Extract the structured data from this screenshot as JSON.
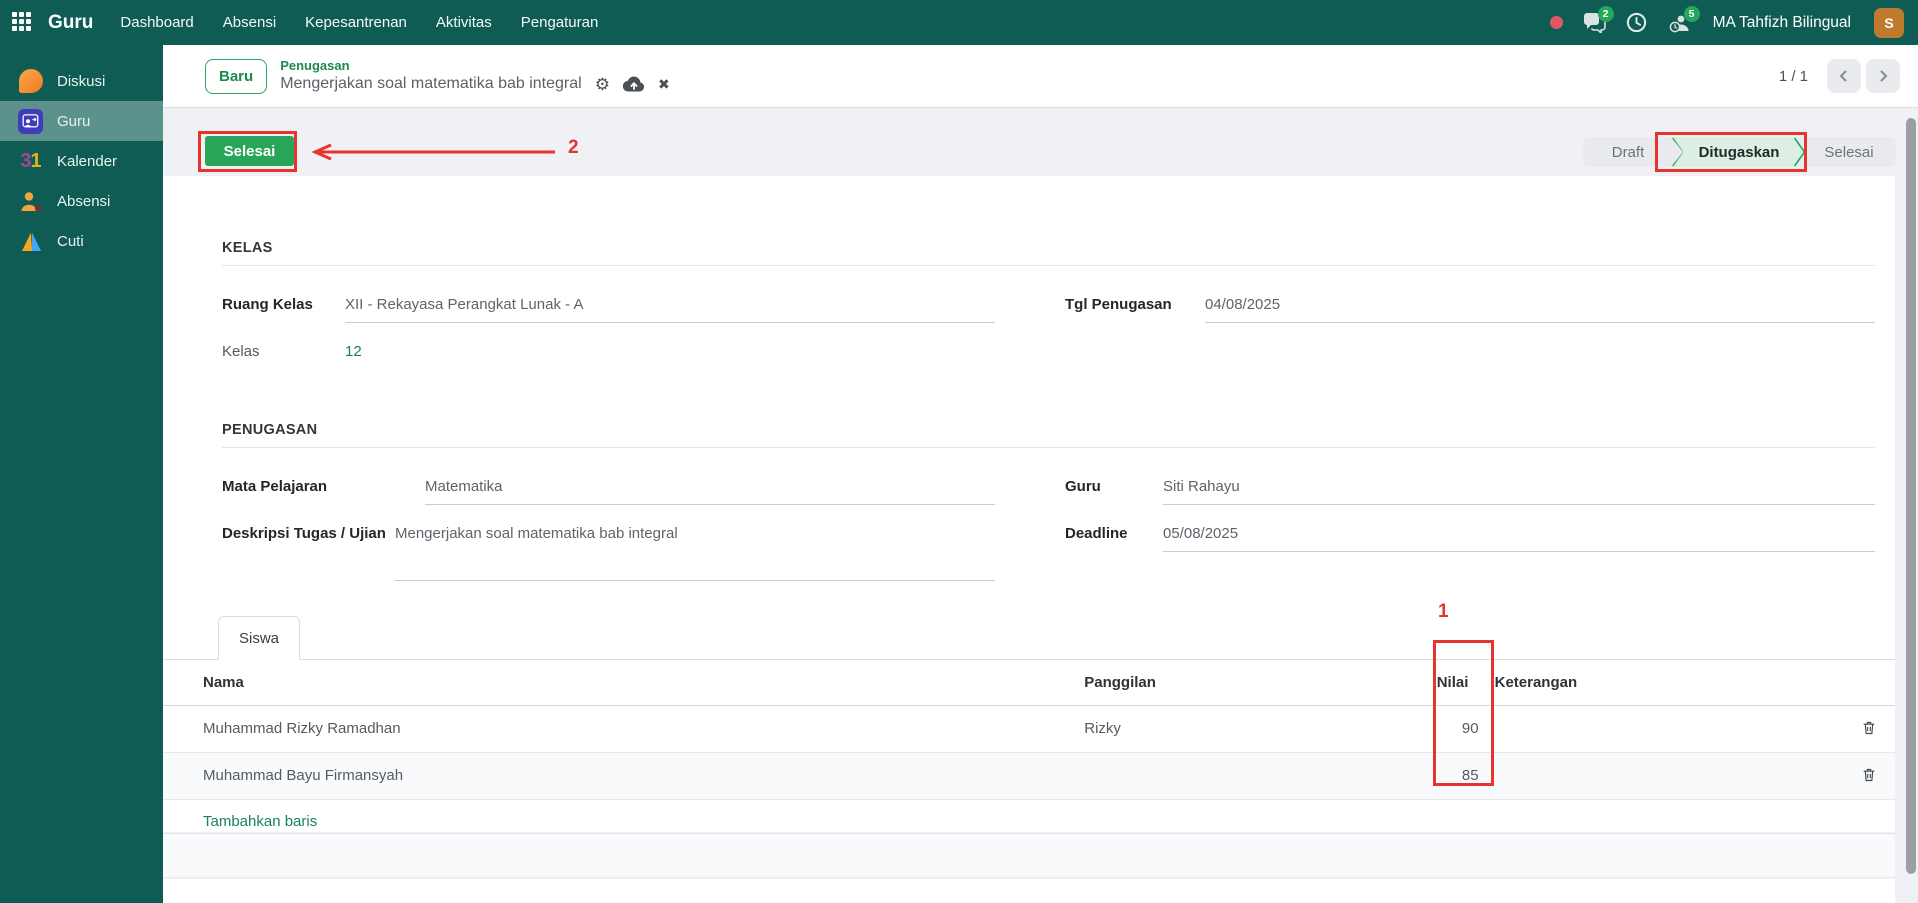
{
  "topbar": {
    "app_name": "Guru",
    "menus": [
      "Dashboard",
      "Absensi",
      "Kepesantrenan",
      "Aktivitas",
      "Pengaturan"
    ],
    "chat_badge": "2",
    "activity_badge": "5",
    "company": "MA Tahfizh Bilingual",
    "avatar_initial": "S"
  },
  "sidebar": {
    "items": [
      {
        "label": "Diskusi"
      },
      {
        "label": "Guru"
      },
      {
        "label": "Kalender",
        "icon_text": "31"
      },
      {
        "label": "Absensi"
      },
      {
        "label": "Cuti"
      }
    ]
  },
  "breadcrumb": {
    "new_button": "Baru",
    "parent": "Penugasan",
    "title": "Mengerjakan soal matematika bab integral",
    "pager": "1 / 1"
  },
  "actions": {
    "mark_done": "Selesai",
    "statusbar": [
      {
        "label": "Draft"
      },
      {
        "label": "Ditugaskan",
        "active": true
      },
      {
        "label": "Selesai"
      }
    ]
  },
  "annotations": {
    "nilai_column": "1",
    "selesai_button": "2"
  },
  "form": {
    "kelas": {
      "heading": "KELAS",
      "ruang_kelas_label": "Ruang Kelas",
      "ruang_kelas_value": "XII - Rekayasa Perangkat Lunak - A",
      "tgl_label": "Tgl Penugasan",
      "tgl_value": "04/08/2025",
      "kelas_label": "Kelas",
      "kelas_value": "12"
    },
    "penugasan": {
      "heading": "PENUGASAN",
      "mapel_label": "Mata Pelajaran",
      "mapel_value": "Matematika",
      "guru_label": "Guru",
      "guru_value": "Siti Rahayu",
      "deskripsi_label": "Deskripsi Tugas / Ujian",
      "deskripsi_value": "Mengerjakan soal matematika bab integral",
      "deadline_label": "Deadline",
      "deadline_value": "05/08/2025"
    },
    "tab_label": "Siswa",
    "table": {
      "headers": [
        "Nama",
        "Panggilan",
        "Nilai",
        "Keterangan"
      ],
      "rows": [
        {
          "nama": "Muhammad Rizky Ramadhan",
          "panggilan": "Rizky",
          "nilai": "90",
          "keterangan": ""
        },
        {
          "nama": "Muhammad Bayu Firmansyah",
          "panggilan": "",
          "nilai": "85",
          "keterangan": ""
        }
      ],
      "add_row_label": "Tambahkan baris"
    }
  },
  "colors": {
    "topbar_teal": "#0e5c54",
    "accent_green": "#28a558",
    "link_green": "#18835a",
    "status_active_bg": "#dcefe2",
    "annotation_red": "#e6342e",
    "avatar_orange": "#c07a2e"
  }
}
